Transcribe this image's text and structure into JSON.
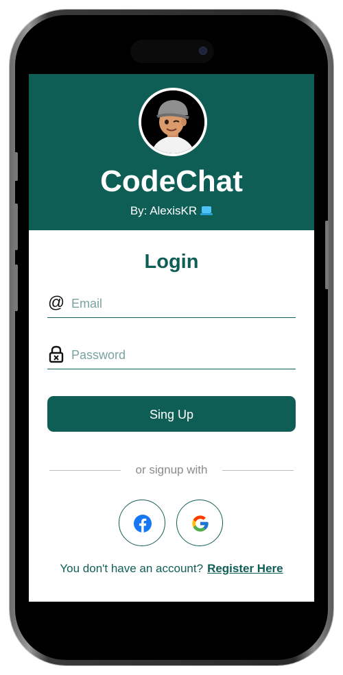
{
  "app": {
    "title": "CodeChat",
    "byline": "By: AlexisKR",
    "accent_color": "#0f5e55"
  },
  "login": {
    "title": "Login",
    "email": {
      "placeholder": "Email",
      "icon": "at-icon"
    },
    "password": {
      "placeholder": "Password",
      "icon": "lock-icon"
    },
    "submit_label": "Sing Up"
  },
  "social": {
    "divider_text": "or signup with",
    "providers": [
      "facebook-icon",
      "google-icon"
    ]
  },
  "register": {
    "prompt": "You don't have an account?",
    "link_label": "Register Here"
  }
}
